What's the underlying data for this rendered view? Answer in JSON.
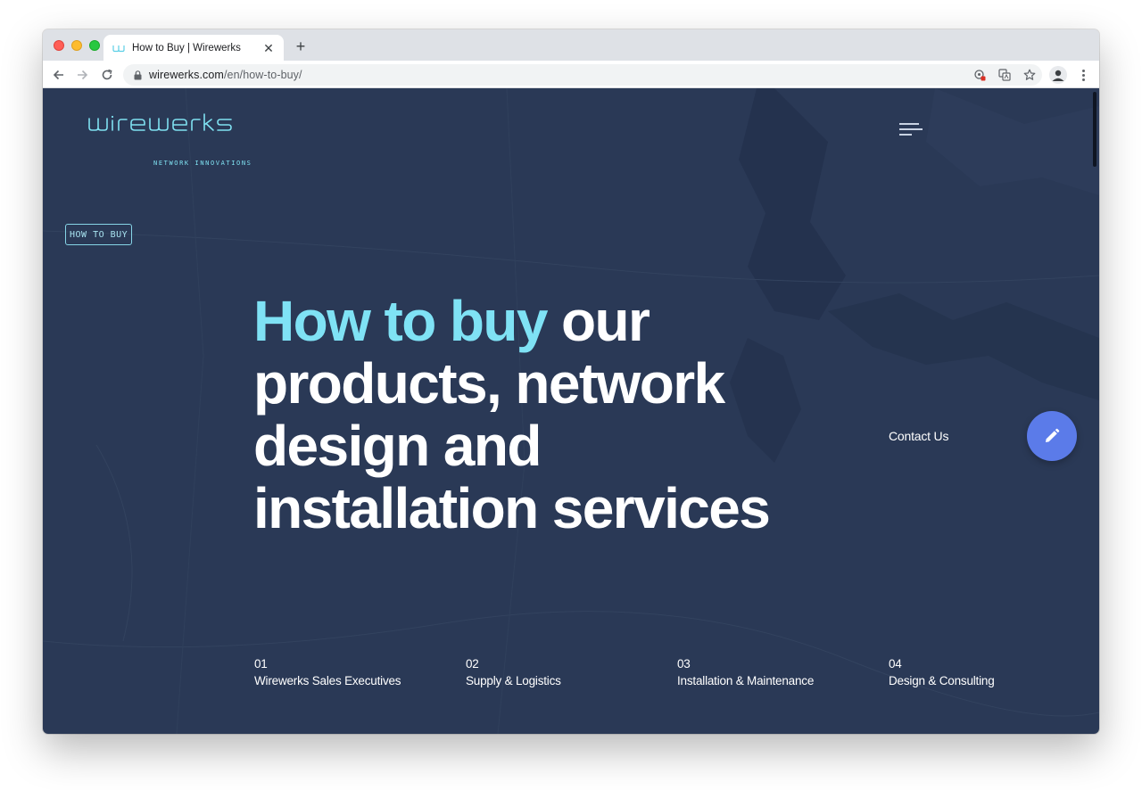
{
  "browser": {
    "tab": {
      "title": "How to Buy | Wirewerks"
    },
    "address": {
      "domain": "wirewerks.com",
      "path": "/en/how-to-buy/"
    },
    "icons": [
      "back-icon",
      "forward-icon",
      "reload-icon",
      "lock-icon",
      "tracking-icon",
      "translate-icon",
      "star-icon",
      "profile-icon",
      "menu-icon"
    ]
  },
  "site": {
    "logo": {
      "word": "wirewerks",
      "tagline": "NETWORK INNOVATIONS"
    },
    "badge": "HOW TO BUY",
    "hero": {
      "accent": "How to buy",
      "rest": " our products, network design and installation services"
    },
    "contact": "Contact Us",
    "steps": [
      {
        "num": "01",
        "label": "Wirewerks Sales Executives"
      },
      {
        "num": "02",
        "label": "Supply & Logistics"
      },
      {
        "num": "03",
        "label": "Installation & Maintenance"
      },
      {
        "num": "04",
        "label": "Design & Consulting"
      }
    ]
  },
  "colors": {
    "page_bg": "#2a3956",
    "accent_cyan": "#7fe2f5",
    "fab_blue": "#5b7be9",
    "text_white": "#ffffff"
  }
}
